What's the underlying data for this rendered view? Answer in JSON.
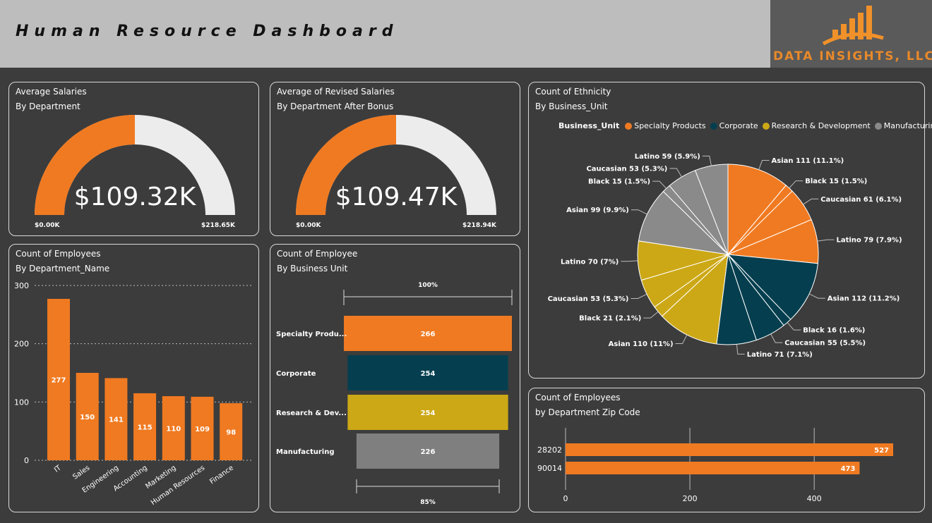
{
  "header": {
    "title": "Human Resource Dashboard",
    "logo_text": "DATA INSIGHTS, LLC."
  },
  "colors": {
    "orange": "#f07a21",
    "teal": "#053f4f",
    "gold": "#cca816",
    "gray": "#8a8a8a",
    "light": "#ececec"
  },
  "gauge1": {
    "title": "Average Salaries",
    "subtitle": "By Department",
    "value_label": "$109.32K",
    "min_label": "$0.00K",
    "max_label": "$218.65K",
    "value": 109.32,
    "max": 218.65
  },
  "gauge2": {
    "title": "Average of Revised Salaries",
    "subtitle": "By Department After Bonus",
    "value_label": "$109.47K",
    "min_label": "$0.00K",
    "max_label": "$218.94K",
    "value": 109.47,
    "max": 218.94
  },
  "dept_chart": {
    "title": "Count of Employees",
    "subtitle": "By Department_Name"
  },
  "funnel": {
    "title": "Count of Employee",
    "subtitle": "By Business Unit",
    "top_label": "100%",
    "bottom_label": "85%"
  },
  "pie": {
    "title": "Count of Ethnicity",
    "subtitle": "By Business_Unit",
    "legend_title": "Business_Unit"
  },
  "zip": {
    "title": "Count of Employees",
    "subtitle": "by Department Zip Code"
  },
  "chart_data": [
    {
      "type": "bar",
      "categories": [
        "IT",
        "Sales",
        "Engineering",
        "Accounting",
        "Marketing",
        "Human Resources",
        "Finance"
      ],
      "values": [
        277,
        150,
        141,
        115,
        110,
        109,
        98
      ],
      "yticks": [
        "0",
        "100",
        "200",
        "300"
      ],
      "ylim": [
        0,
        300
      ]
    },
    {
      "type": "bar",
      "orientation": "funnel",
      "categories": [
        "Specialty Produ...",
        "Corporate",
        "Research & Dev...",
        "Manufacturing"
      ],
      "values": [
        266,
        254,
        254,
        226
      ]
    },
    {
      "type": "pie",
      "legend": [
        "Specialty Products",
        "Corporate",
        "Research & Development",
        "Manufacturing"
      ],
      "slices": [
        {
          "group": 0,
          "value": 111,
          "label": "Asian 111 (11.1%)"
        },
        {
          "group": 0,
          "value": 15,
          "label": "Black 15 (1.5%)"
        },
        {
          "group": 0,
          "value": 61,
          "label": "Caucasian 61 (6.1%)"
        },
        {
          "group": 0,
          "value": 79,
          "label": "Latino 79 (7.9%)"
        },
        {
          "group": 1,
          "value": 112,
          "label": "Asian 112 (11.2%)"
        },
        {
          "group": 1,
          "value": 16,
          "label": "Black 16 (1.6%)"
        },
        {
          "group": 1,
          "value": 55,
          "label": "Caucasian 55 (5.5%)"
        },
        {
          "group": 1,
          "value": 71,
          "label": "Latino 71 (7.1%)"
        },
        {
          "group": 2,
          "value": 110,
          "label": "Asian 110 (11%)"
        },
        {
          "group": 2,
          "value": 21,
          "label": "Black 21 (2.1%)"
        },
        {
          "group": 2,
          "value": 53,
          "label": "Caucasian 53 (5.3%)"
        },
        {
          "group": 2,
          "value": 70,
          "label": "Latino 70 (7%)"
        },
        {
          "group": 3,
          "value": 99,
          "label": "Asian 99 (9.9%)"
        },
        {
          "group": 3,
          "value": 15,
          "label": "Black 15 (1.5%)"
        },
        {
          "group": 3,
          "value": 53,
          "label": "Caucasian 53 (5.3%)"
        },
        {
          "group": 3,
          "value": 59,
          "label": "Latino 59 (5.9%)"
        }
      ]
    },
    {
      "type": "bar",
      "orientation": "horizontal",
      "categories": [
        "28202",
        "90014"
      ],
      "values": [
        527,
        473
      ],
      "xticks": [
        "0",
        "200",
        "400"
      ],
      "xlim": [
        0,
        527
      ]
    }
  ]
}
